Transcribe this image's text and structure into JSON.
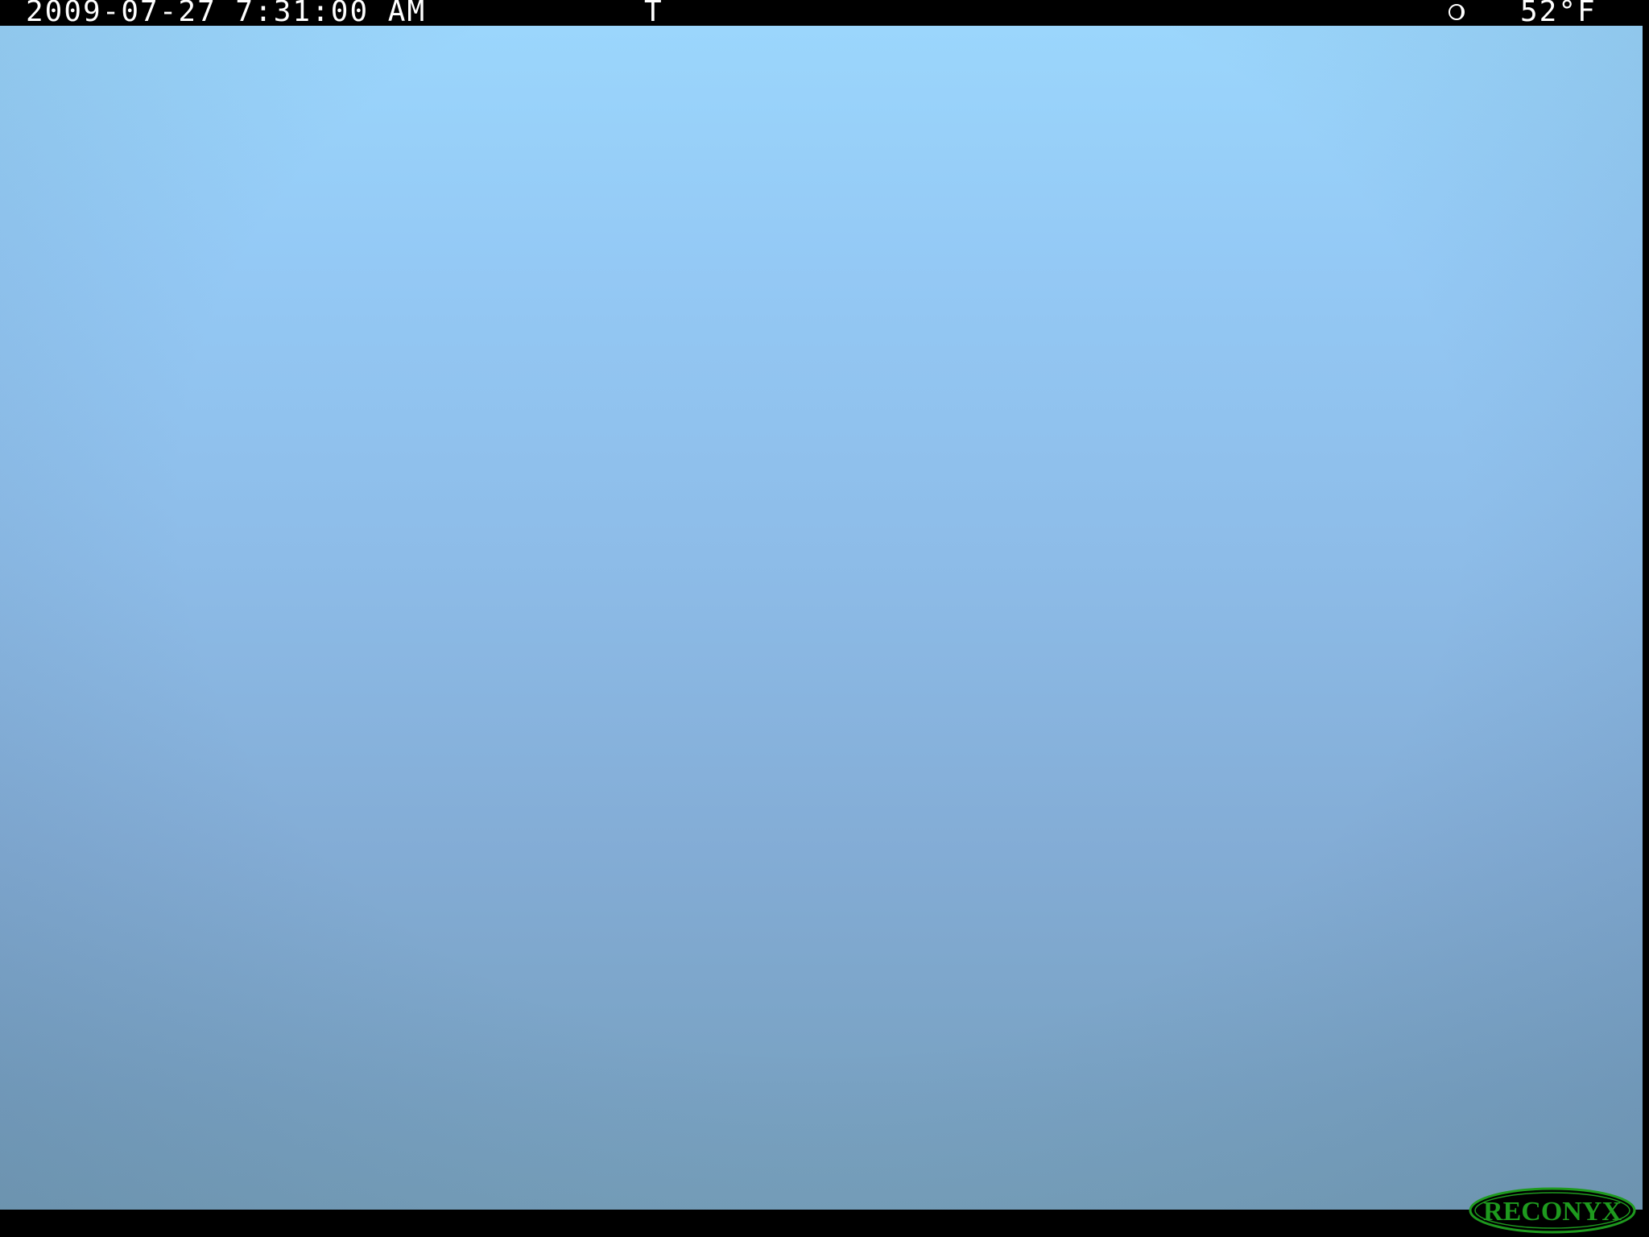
{
  "timestamp_bar": {
    "datetime": "2009-07-27 7:31:00 AM",
    "trigger": "T",
    "moon_phase_icon": "moon-phase-icon",
    "temperature": "52°F"
  },
  "logo": {
    "text": "RECONYX",
    "color": "#1e9a1e",
    "background": "#000000"
  },
  "scene": {
    "sky_top_color": "#9bd6fc",
    "sky_bottom_color": "#77a0bb"
  }
}
